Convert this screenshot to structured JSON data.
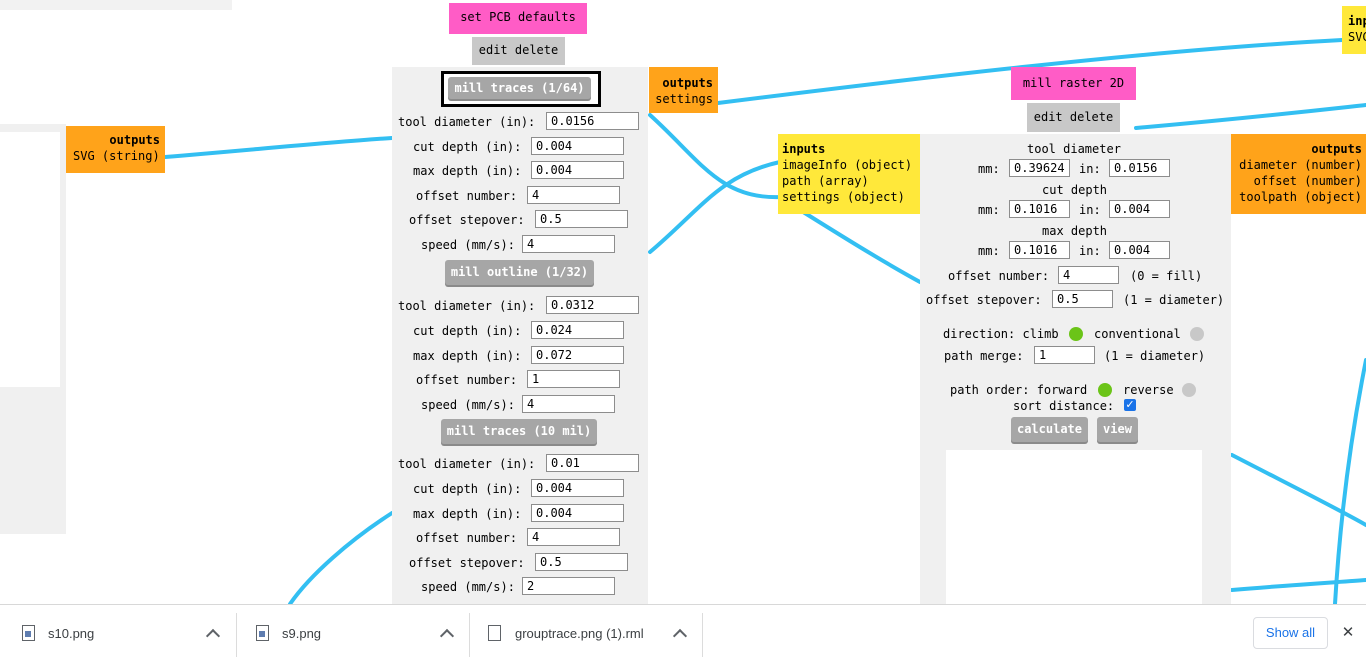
{
  "left_node": {
    "outputs_title": "outputs",
    "outputs_line": "SVG (string)"
  },
  "pcb_defaults": {
    "title": "set PCB defaults",
    "actions": "edit delete",
    "outputs_title": "outputs",
    "outputs_line": "settings",
    "sections": [
      {
        "button": "mill traces (1/64)",
        "rows": [
          {
            "label": "tool diameter (in):",
            "value": "0.0156"
          },
          {
            "label": "cut depth (in):",
            "value": "0.004"
          },
          {
            "label": "max depth (in):",
            "value": "0.004"
          },
          {
            "label": "offset number:",
            "value": "4"
          },
          {
            "label": "offset stepover:",
            "value": "0.5"
          },
          {
            "label": "speed (mm/s):",
            "value": "4"
          }
        ]
      },
      {
        "button": "mill outline (1/32)",
        "rows": [
          {
            "label": "tool diameter (in):",
            "value": "0.0312"
          },
          {
            "label": "cut depth (in):",
            "value": "0.024"
          },
          {
            "label": "max depth (in):",
            "value": "0.072"
          },
          {
            "label": "offset number:",
            "value": "1"
          },
          {
            "label": "speed (mm/s):",
            "value": "4"
          }
        ]
      },
      {
        "button": "mill traces (10 mil)",
        "rows": [
          {
            "label": "tool diameter (in):",
            "value": "0.01"
          },
          {
            "label": "cut depth (in):",
            "value": "0.004"
          },
          {
            "label": "max depth (in):",
            "value": "0.004"
          },
          {
            "label": "offset number:",
            "value": "4"
          },
          {
            "label": "offset stepover:",
            "value": "0.5"
          },
          {
            "label": "speed (mm/s):",
            "value": "2"
          }
        ]
      }
    ]
  },
  "raster": {
    "title": "mill raster 2D",
    "actions": "edit delete",
    "inputs_title": "inputs",
    "inputs": [
      "imageInfo (object)",
      "path (array)",
      "settings (object)"
    ],
    "outputs_title": "outputs",
    "outputs": [
      "diameter (number)",
      "offset (number)",
      "toolpath (object)"
    ],
    "tool_diameter_label": "tool diameter",
    "cut_depth_label": "cut depth",
    "max_depth_label": "max depth",
    "mm_label": "mm:",
    "in_label": "in:",
    "tool_diameter_mm": "0.39624",
    "tool_diameter_in": "0.0156",
    "cut_depth_mm": "0.1016",
    "cut_depth_in": "0.004",
    "max_depth_mm": "0.1016",
    "max_depth_in": "0.004",
    "offset_number_label": "offset number:",
    "offset_number": "4",
    "offset_number_hint": "(0 = fill)",
    "offset_stepover_label": "offset stepover:",
    "offset_stepover": "0.5",
    "offset_stepover_hint": "(1 = diameter)",
    "direction_label": "direction: climb",
    "direction_alt": "conventional",
    "path_merge_label": "path merge:",
    "path_merge": "1",
    "path_merge_hint": "(1 = diameter)",
    "path_order_label": "path order: forward",
    "path_order_alt": "reverse",
    "sort_distance_label": "sort distance:",
    "calculate_label": "calculate",
    "view_label": "view"
  },
  "right_edge_node": {
    "title_fragment": "inp",
    "line_fragment": "SVG"
  },
  "downloads": {
    "items": [
      {
        "name": "s10.png"
      },
      {
        "name": "s9.png"
      },
      {
        "name": "grouptrace.png (1).rml"
      }
    ],
    "show_all": "Show all",
    "close_symbol": "✕"
  },
  "colors": {
    "wire": "#33bff2",
    "pink": "#ff5cc6",
    "orange": "#ffa31a",
    "yellow": "#ffe83a",
    "green": "#6bc418"
  }
}
